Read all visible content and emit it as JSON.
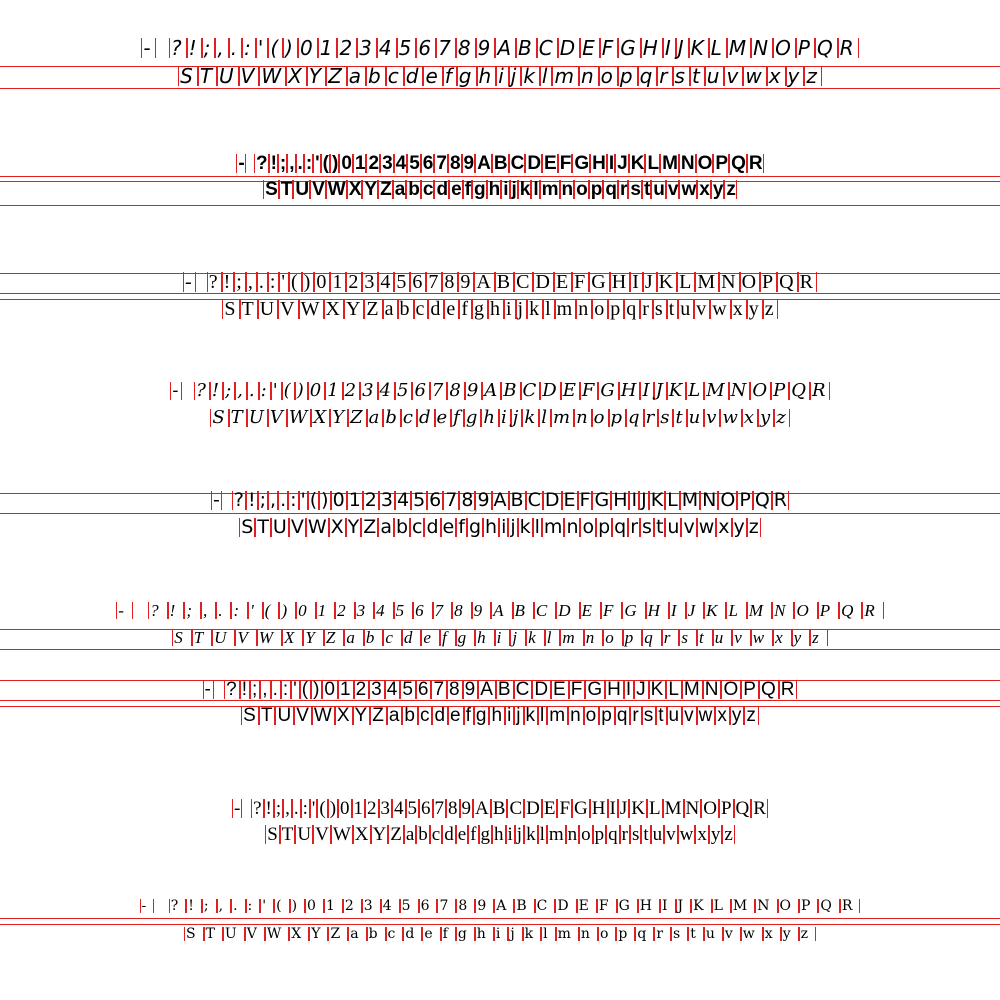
{
  "line1": "- ?!;,.:'()0123456789ABCDEFGHIJKLMNOPQR",
  "line2": "STUVWXYZabcdefghijklmnopqrstuvwxyz",
  "guide_color": "#e02020",
  "text_color": "#000000"
}
